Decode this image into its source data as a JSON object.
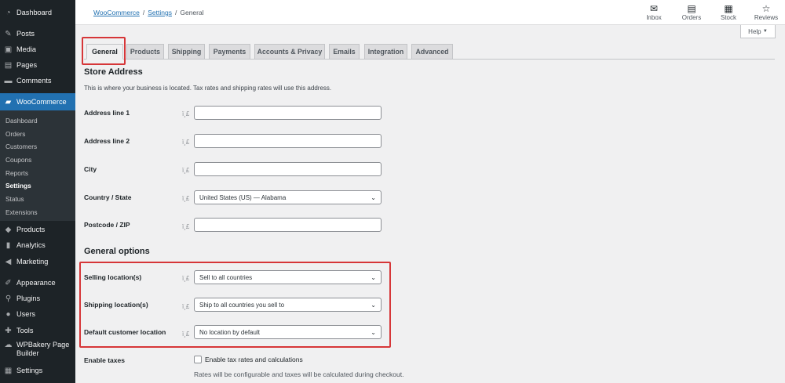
{
  "sidebar": {
    "items": [
      {
        "label": "Dashboard",
        "icon": "dashboard-icon",
        "glyph": "◔"
      },
      {
        "label": "Posts",
        "icon": "pin-icon",
        "glyph": "✎"
      },
      {
        "label": "Media",
        "icon": "media-icon",
        "glyph": "▣"
      },
      {
        "label": "Pages",
        "icon": "pages-icon",
        "glyph": "▤"
      },
      {
        "label": "Comments",
        "icon": "comments-icon",
        "glyph": "▬"
      },
      {
        "label": "WooCommerce",
        "icon": "woocommerce-icon",
        "glyph": "▰"
      },
      {
        "label": "Products",
        "icon": "products-icon",
        "glyph": "◆"
      },
      {
        "label": "Analytics",
        "icon": "analytics-icon",
        "glyph": "▮"
      },
      {
        "label": "Marketing",
        "icon": "marketing-icon",
        "glyph": "◀"
      },
      {
        "label": "Appearance",
        "icon": "appearance-icon",
        "glyph": "✐"
      },
      {
        "label": "Plugins",
        "icon": "plugins-icon",
        "glyph": "⚲"
      },
      {
        "label": "Users",
        "icon": "users-icon",
        "glyph": "●"
      },
      {
        "label": "Tools",
        "icon": "tools-icon",
        "glyph": "✚"
      },
      {
        "label": "WPBakery Page",
        "label2": "Builder",
        "icon": "wpbakery-icon",
        "glyph": "☁"
      },
      {
        "label": "Settings",
        "icon": "settings-icon",
        "glyph": "▦"
      }
    ],
    "submenu": [
      "Dashboard",
      "Orders",
      "Customers",
      "Coupons",
      "Reports",
      "Settings",
      "Status",
      "Extensions"
    ]
  },
  "breadcrumb": {
    "woo": "WooCommerce",
    "settings": "Settings",
    "current": "General",
    "sep": "/"
  },
  "toolbar": [
    {
      "label": "Inbox",
      "icon": "inbox-icon",
      "glyph": "✉"
    },
    {
      "label": "Orders",
      "icon": "orders-icon",
      "glyph": "▤"
    },
    {
      "label": "Stock",
      "icon": "stock-icon",
      "glyph": "▦"
    },
    {
      "label": "Reviews",
      "icon": "reviews-icon",
      "glyph": "☆"
    }
  ],
  "help": {
    "label": "Help",
    "arrow": "▼"
  },
  "tabs": [
    "General",
    "Products",
    "Shipping",
    "Payments",
    "Accounts & Privacy",
    "Emails",
    "Integration",
    "Advanced"
  ],
  "store_address": {
    "title": "Store Address",
    "description": "This is where your business is located. Tax rates and shipping rates will use this address.",
    "fields": [
      {
        "label": "Address line 1",
        "value": ""
      },
      {
        "label": "Address line 2",
        "value": ""
      },
      {
        "label": "City",
        "value": ""
      },
      {
        "label": "Country / State",
        "value": "United States (US) — Alabama"
      },
      {
        "label": "Postcode / ZIP",
        "value": ""
      }
    ]
  },
  "general_options": {
    "title": "General options",
    "fields": [
      {
        "label": "Selling location(s)",
        "value": "Sell to all countries"
      },
      {
        "label": "Shipping location(s)",
        "value": "Ship to all countries you sell to"
      },
      {
        "label": "Default customer location",
        "value": "No location by default"
      }
    ]
  },
  "taxes": {
    "label": "Enable taxes",
    "checkbox_label": "Enable tax rates and calculations",
    "checked": false,
    "note": "Rates will be configurable and taxes will be calculated during checkout."
  },
  "tip_glyph": "ï¸£",
  "chevron_glyph": "⌄",
  "colors": {
    "sidebar": "#1d2327",
    "accent": "#2271b1",
    "highlight": "#d63638"
  }
}
